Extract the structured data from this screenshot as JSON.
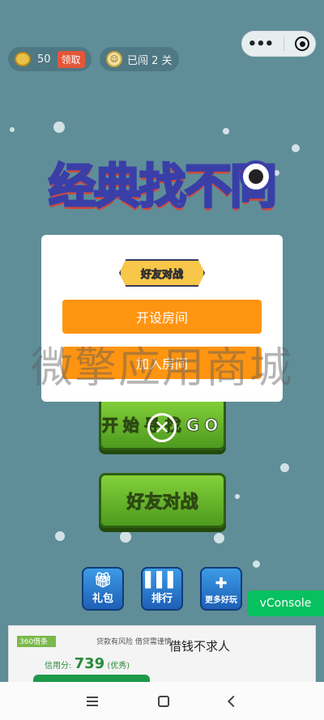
{
  "topbar": {
    "coins_value": "50",
    "claim_label": "领取",
    "level_label": "已闯 2 关"
  },
  "logo": {
    "text": "经典找不同"
  },
  "buttons": {
    "start_label": "开始寻找GO",
    "friend_battle_label": "好友对战"
  },
  "icons": {
    "gift_label": "礼包",
    "rank_label": "排行",
    "more_games_label": "更多好玩"
  },
  "vconsole_label": "vConsole",
  "ad": {
    "logo_text": "360借条",
    "brand": "借条",
    "line1": "贷款有风险 借贷需谨慎",
    "title": "借钱不求人",
    "score_label": "信用分:",
    "score_value": "739",
    "score_grade": "(优秀)"
  },
  "modal": {
    "title": "好友对战",
    "create_room_label": "开设房间",
    "join_room_label": "加入房间"
  },
  "watermark": "微擎应用商城",
  "colors": {
    "background": "#5f8e98",
    "modal_button": "#ff9410",
    "game_button": "#5fae28",
    "vconsole": "#07c160"
  }
}
